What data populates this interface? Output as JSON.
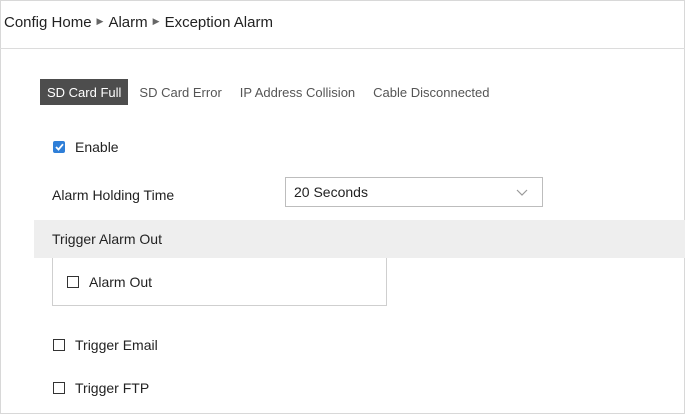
{
  "breadcrumb": {
    "items": [
      "Config Home",
      "Alarm",
      "Exception Alarm"
    ],
    "separator": "▶"
  },
  "tabs": [
    {
      "label": "SD Card Full",
      "active": true
    },
    {
      "label": "SD Card Error",
      "active": false
    },
    {
      "label": "IP Address Collision",
      "active": false
    },
    {
      "label": "Cable Disconnected",
      "active": false
    }
  ],
  "enable": {
    "label": "Enable",
    "checked": true
  },
  "holding_time": {
    "label": "Alarm Holding Time",
    "value": "20 Seconds"
  },
  "trigger_alarm_out": {
    "label": "Trigger Alarm Out"
  },
  "alarm_out": {
    "label": "Alarm Out",
    "checked": false
  },
  "trigger_email": {
    "label": "Trigger Email",
    "checked": false
  },
  "trigger_ftp": {
    "label": "Trigger FTP",
    "checked": false
  },
  "colors": {
    "active_tab_bg": "#4d4d4d",
    "checkbox_accent": "#2f7fd8",
    "band_bg": "#eeeeee"
  }
}
